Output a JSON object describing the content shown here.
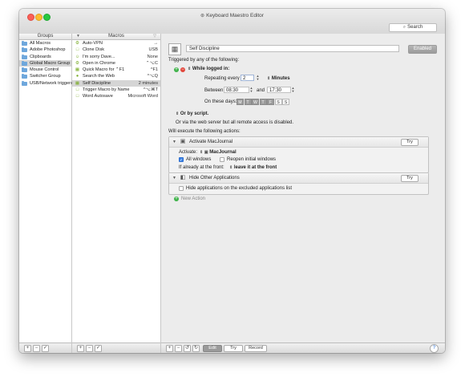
{
  "window": {
    "title": "Keyboard Maestro Editor",
    "title_icon": "terminal-icon"
  },
  "search": {
    "label": "Search",
    "icon": "magnifier-icon"
  },
  "groups": {
    "header": "Groups",
    "items": [
      {
        "label": "All Macros"
      },
      {
        "label": "Adobe Photoshop"
      },
      {
        "label": "Clipboards"
      },
      {
        "label": "Global Macro Group"
      },
      {
        "label": "Mouse Control"
      },
      {
        "label": "Switcher Group"
      },
      {
        "label": "USB/Network triggers"
      }
    ],
    "selected_index": 3
  },
  "macros": {
    "header": "Macros",
    "items": [
      {
        "label": "Auto-VPN",
        "trigger": "→"
      },
      {
        "label": "Clone Disk",
        "trigger": "USB"
      },
      {
        "label": "I'm sorry Dave...",
        "trigger": "None"
      },
      {
        "label": "Open in Chrome",
        "trigger": "⌃⌥C"
      },
      {
        "label": "Quick Macro for ⌃F1",
        "trigger": "^F1"
      },
      {
        "label": "Search the Web",
        "trigger": "^⌥Q"
      },
      {
        "label": "Self Discipline",
        "trigger": "2 minutes"
      },
      {
        "label": "Trigger Macro by Name",
        "trigger": "^⌥⌘T"
      },
      {
        "label": "Word Autosave",
        "trigger": "Microsoft Word"
      }
    ],
    "selected_index": 6
  },
  "editor": {
    "macro_name": "Self Discipline",
    "enabled_label": "Enabled",
    "triggered_label": "Triggered by any of the following:",
    "trigger_type": "While logged in:",
    "repeating_label": "Repeating every",
    "repeat_value": "2",
    "repeat_unit": "Minutes",
    "between_label": "Between",
    "start_time": "08:30",
    "and_label": "and",
    "end_time": "17:30",
    "on_days_label": "On these days:",
    "days": [
      "M",
      "T",
      "W",
      "T",
      "F",
      "S",
      "S"
    ],
    "days_on": [
      true,
      true,
      true,
      true,
      true,
      false,
      false
    ],
    "or_script": "Or by script.",
    "web_server_note": "Or via the web server but all remote access is disabled.",
    "will_execute": "Will execute the following actions:",
    "actions": [
      {
        "title": "Activate MacJournal",
        "try_label": "Try",
        "activate_label": "Activate:",
        "app_name": "MacJournal",
        "all_windows": "All windows",
        "reopen": "Reopen initial windows",
        "front_label": "If already at the front:",
        "front_option": "leave it at the front"
      },
      {
        "title": "Hide Other Applications",
        "try_label": "Try",
        "hide_excluded": "Hide applications on the excluded applications list"
      }
    ],
    "new_action": "New Action"
  },
  "bottom": {
    "edit": "Edit",
    "try": "Try",
    "record": "Record",
    "help": "?"
  }
}
